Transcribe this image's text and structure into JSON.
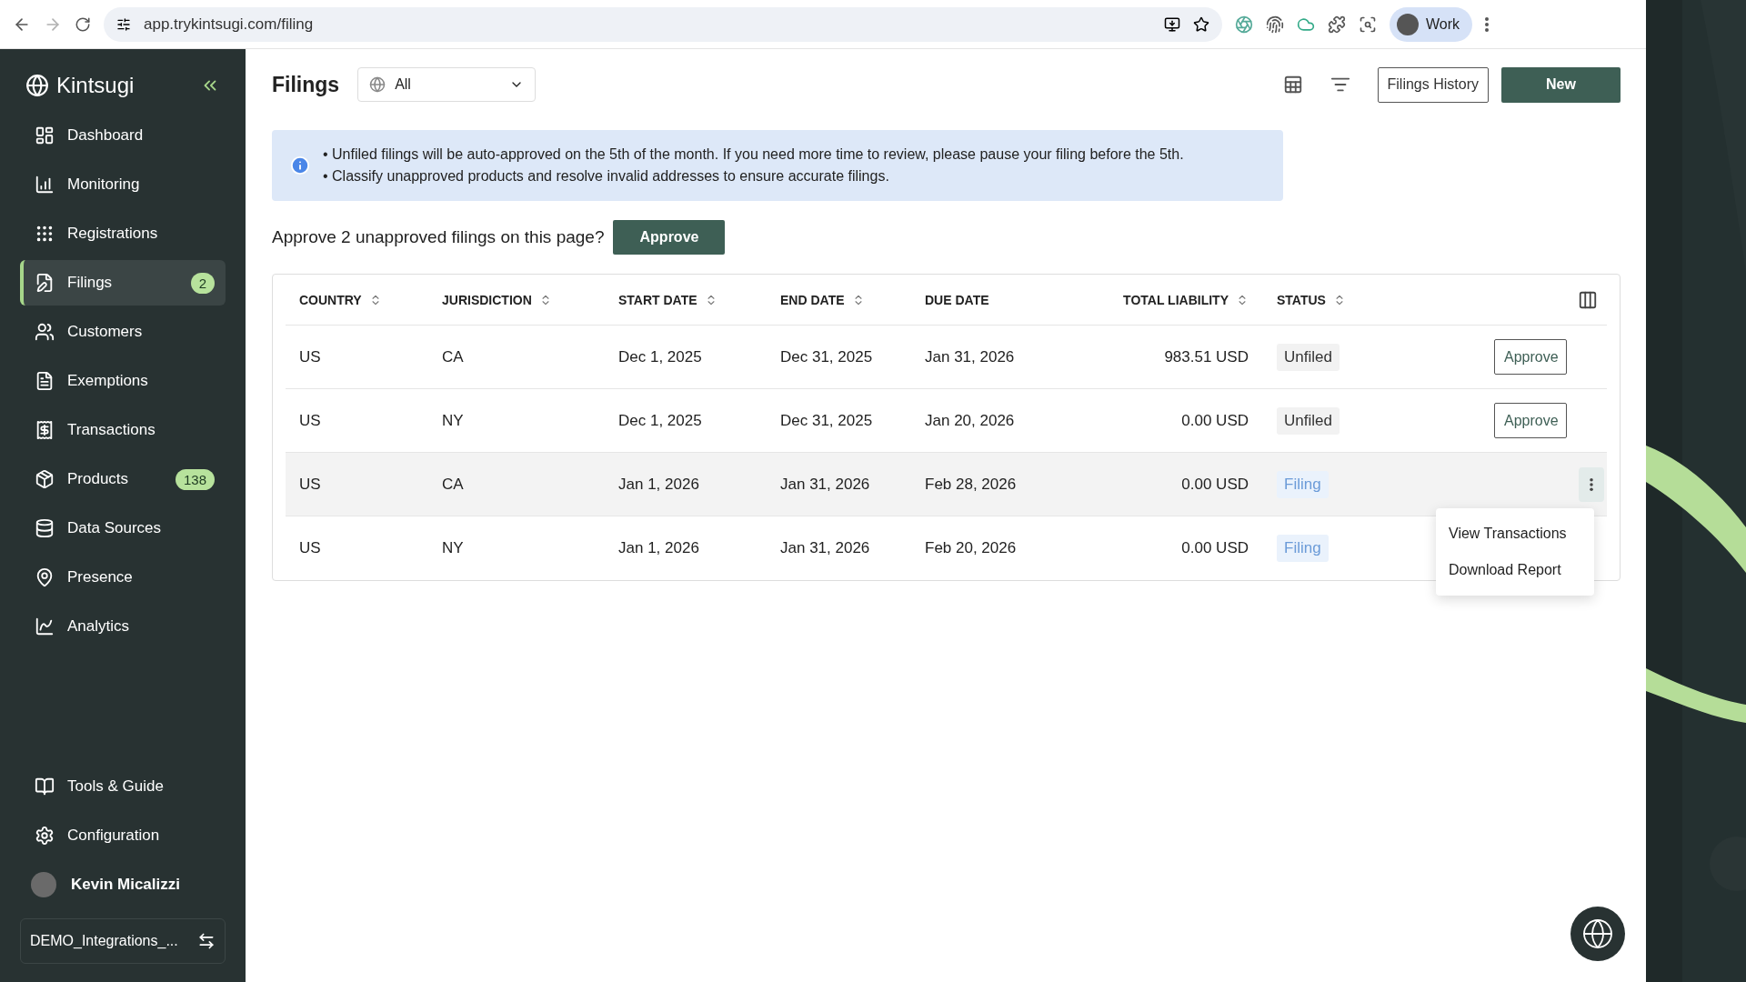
{
  "browser": {
    "url": "app.trykintsugi.com/filing",
    "profile": "Work"
  },
  "sidebar": {
    "brand": "Kintsugi",
    "items": [
      {
        "label": "Dashboard",
        "selected": false
      },
      {
        "label": "Monitoring",
        "selected": false
      },
      {
        "label": "Registrations",
        "selected": false
      },
      {
        "label": "Filings",
        "selected": true,
        "badge": "2"
      },
      {
        "label": "Customers",
        "selected": false
      },
      {
        "label": "Exemptions",
        "selected": false
      },
      {
        "label": "Transactions",
        "selected": false
      },
      {
        "label": "Products",
        "selected": false,
        "badge": "138"
      },
      {
        "label": "Data Sources",
        "selected": false
      },
      {
        "label": "Presence",
        "selected": false
      },
      {
        "label": "Analytics",
        "selected": false
      }
    ],
    "bottom_items": [
      {
        "label": "Tools & Guide"
      },
      {
        "label": "Configuration"
      }
    ],
    "user": "Kevin Micalizzi",
    "workspace": "DEMO_Integrations_..."
  },
  "header": {
    "title": "Filings",
    "region_select": "All",
    "buttons": [
      "Filings History",
      "New"
    ]
  },
  "notice": [
    "• Unfiled filings will be auto-approved on the 5th of the month. If you need more time to review, please pause your filing before the 5th.",
    "• Classify unapproved products and resolve invalid addresses to ensure accurate filings."
  ],
  "approve_bar": {
    "text": "Approve 2 unapproved filings on this page?",
    "button": "Approve"
  },
  "table": {
    "columns": [
      {
        "label": "COUNTRY",
        "sortable": true
      },
      {
        "label": "JURISDICTION",
        "sortable": true
      },
      {
        "label": "START DATE",
        "sortable": true
      },
      {
        "label": "END DATE",
        "sortable": true
      },
      {
        "label": "DUE DATE",
        "sortable": false
      },
      {
        "label": "TOTAL LIABILITY",
        "sortable": true
      },
      {
        "label": "STATUS",
        "sortable": true
      }
    ],
    "rows": [
      {
        "cells": [
          "US",
          "CA",
          "Dec 1, 2025",
          "Dec 31, 2025",
          "Jan 31, 2026",
          "983.51 USD"
        ],
        "status": {
          "label": "Unfiled",
          "kind": "unfiled"
        },
        "action": {
          "kind": "approve",
          "label": "Approve"
        },
        "hovered": false
      },
      {
        "cells": [
          "US",
          "NY",
          "Dec 1, 2025",
          "Dec 31, 2025",
          "Jan 20, 2026",
          "0.00 USD"
        ],
        "status": {
          "label": "Unfiled",
          "kind": "unfiled"
        },
        "action": {
          "kind": "approve",
          "label": "Approve"
        },
        "hovered": false
      },
      {
        "cells": [
          "US",
          "CA",
          "Jan 1, 2026",
          "Jan 31, 2026",
          "Feb 28, 2026",
          "0.00 USD"
        ],
        "status": {
          "label": "Filing",
          "kind": "filing"
        },
        "action": {
          "kind": "menu"
        },
        "hovered": true
      },
      {
        "cells": [
          "US",
          "NY",
          "Jan 1, 2026",
          "Jan 31, 2026",
          "Feb 20, 2026",
          "0.00 USD"
        ],
        "status": {
          "label": "Filing",
          "kind": "filing"
        },
        "hovered": false
      }
    ],
    "row_menu": {
      "items": [
        "View Transactions",
        "Download Report"
      ]
    }
  }
}
